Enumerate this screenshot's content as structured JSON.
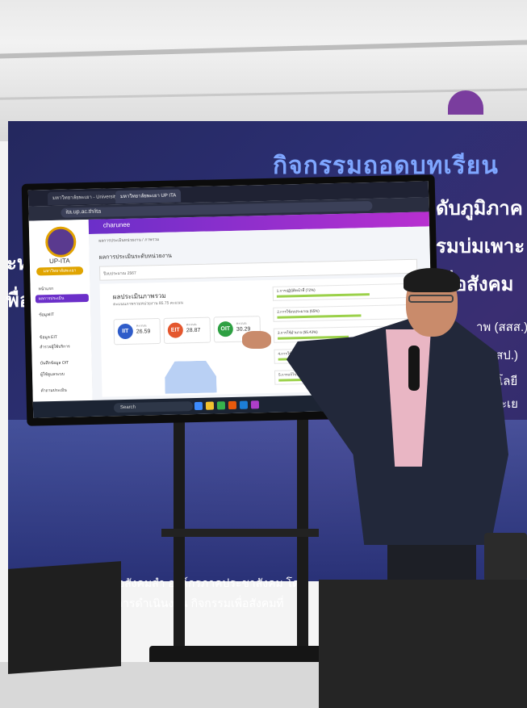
{
  "banner": {
    "title": "กิจกรรมถอดบทเรียน",
    "line1": "ดับภูมิภาค",
    "line2": "รมบ่มเพาะ",
    "line3": "พื่อสังคม",
    "left_fragment_1": "ะห",
    "left_fragment_2": "พื่อ",
    "orgs": [
      "าพ (สสส.)",
      "(สสป.)",
      "นโลยี",
      "ะเย"
    ],
    "bottom_line1": "กิจเพื่อสังคมสำ องค์กรภาคประชาสังคม โดย",
    "bottom_line2": "ยอดการดำเนินงาน กิจกรรมเพื่อสังคมที่"
  },
  "browser": {
    "tabs": [
      "มหาวิทยาลัยพะเยา - University of",
      "มหาวิทยาลัยพะเยา UP ITA"
    ],
    "url": "ita.up.ac.th/ita"
  },
  "app": {
    "user": "charunee",
    "logo_name": "UP-ITA",
    "pill": "มหาวิทยาลัยพะเยา",
    "sidebar": [
      "หน้าแรก",
      "ผลการประเมิน",
      "ข้อมูลIIT",
      "ข้อมูล EIT",
      "สำรวจผู้ใช้บริการ",
      "บันทึกข้อมูล OIT",
      "ผู้ใช้ดูแลระบบ",
      "คำถามประเมิน"
    ],
    "breadcrumb": "ผลการประเมินหน่วยงาน / ภาพรวม",
    "heading": "ผลการประเมินระดับหน่วยงาน",
    "filter_label": "ปีงบประมาณ 2567",
    "card_title": "ผลประเมินภาพรวม",
    "card_sub": "คะแนนภาพรวมหน่วยงาน 85.75 คะแนน",
    "kpis": [
      {
        "name": "IIT",
        "label": "คะแนน",
        "value": "26.59",
        "color": "#2f5cc9"
      },
      {
        "name": "EIT",
        "label": "คะแนน",
        "value": "28.87",
        "color": "#e4572e"
      },
      {
        "name": "OIT",
        "label": "คะแนน",
        "value": "30.29",
        "color": "#2ea043"
      }
    ],
    "bars": [
      {
        "label": "1.การปฏิบัติหน้าที่ (72%)",
        "fill": 0.72
      },
      {
        "label": "2.การใช้งบประมาณ (65%)",
        "fill": 0.65
      },
      {
        "label": "3.การใช้อำนาจ (55.43%)",
        "fill": 0.55
      },
      {
        "label": "4.การใช้ทรัพย์สิน (58.40%)",
        "fill": 0.58
      },
      {
        "label": "5.การแก้ไขปัญหาการทุจริต (50.87%)",
        "fill": 0.51
      }
    ]
  },
  "taskbar": {
    "search": "Search"
  }
}
